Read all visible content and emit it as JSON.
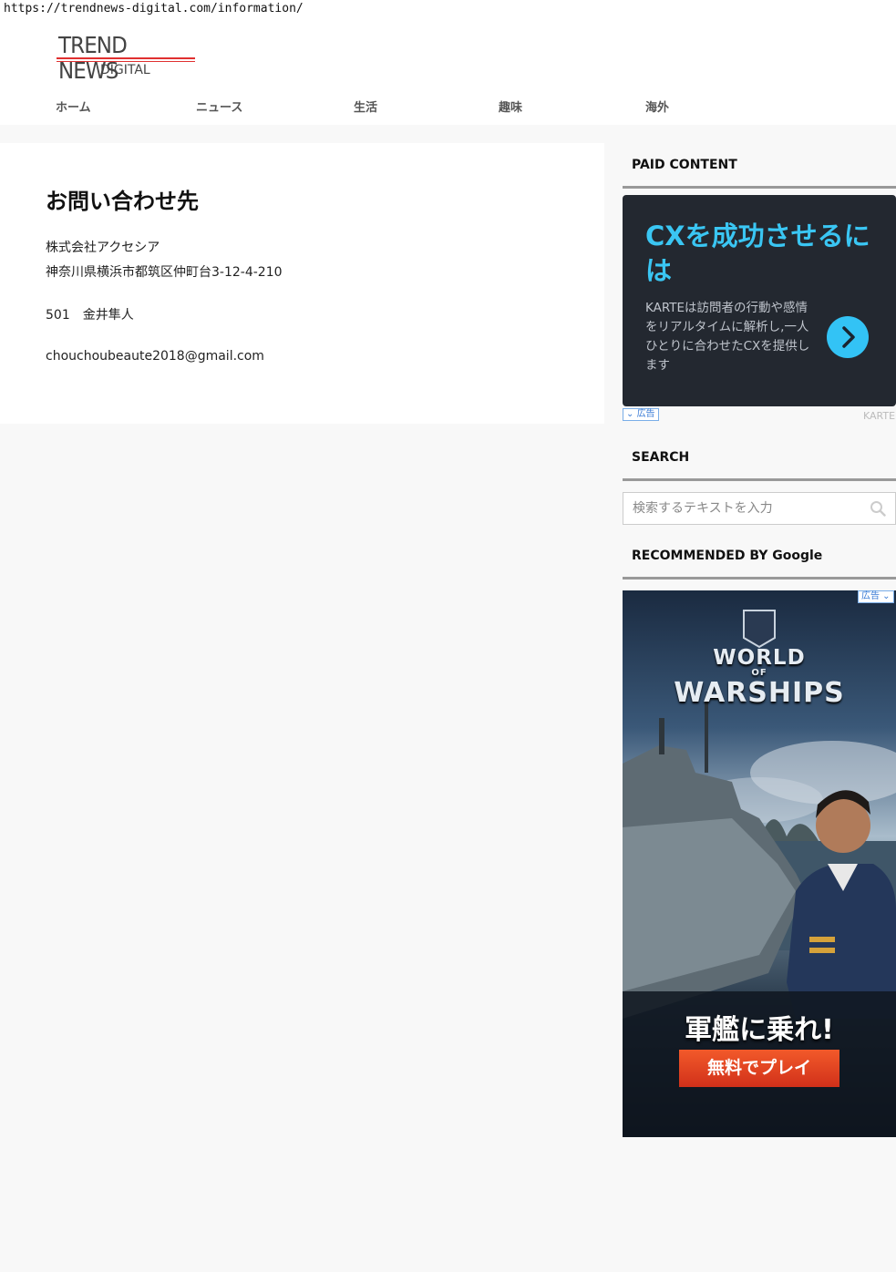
{
  "browser": {
    "url": "https://trendnews-digital.com/information/"
  },
  "site": {
    "logo_line1": "TREND NEWS",
    "logo_line2": "DIGITAL"
  },
  "nav": [
    {
      "label": "ホーム"
    },
    {
      "label": "ニュース"
    },
    {
      "label": "生活"
    },
    {
      "label": "趣味"
    },
    {
      "label": "海外"
    }
  ],
  "content": {
    "title": "お問い合わせ先",
    "company": "株式会社アクセシア",
    "address": "神奈川県横浜市都筑区仲町台3-12-4-210",
    "room_person": "501　金井隼人",
    "email": "chouchoubeaute2018@gmail.com"
  },
  "sidebar": {
    "paid_title": "PAID CONTENT",
    "ad1": {
      "headline": "CXを成功させるには",
      "body": "KARTEは訪問者の行動や感情をリアルタイムに解析し,一人ひとりに合わせたCXを提供します",
      "ad_label": "広告",
      "brand": "KARTE"
    },
    "search_title": "SEARCH",
    "search_placeholder": "検索するテキストを入力",
    "recommended_title": "RECOMMENDED BY Google",
    "ad2": {
      "ad_label": "広告",
      "game_logo_1": "WORLD",
      "game_logo_2": "OF",
      "game_logo_3": "WARSHIPS",
      "tagline": "軍艦に乗れ!",
      "cta": "無料でプレイ"
    }
  },
  "colors": {
    "accent_cyan": "#3ac6f3",
    "cta_red": "#e8401c",
    "logo_red": "#e03030"
  }
}
